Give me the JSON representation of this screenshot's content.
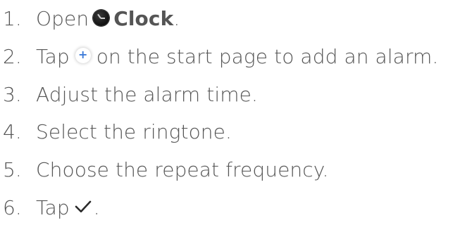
{
  "steps": [
    {
      "number": "1.",
      "before": "Open",
      "icon": "clock-app-icon",
      "app_name": "Clock",
      "after": "."
    },
    {
      "number": "2.",
      "before": "Tap",
      "icon": "add-icon",
      "icon_glyph": "+",
      "after": "on the start page to add an alarm."
    },
    {
      "number": "3.",
      "text": "Adjust the alarm time."
    },
    {
      "number": "4.",
      "text": "Select the ringtone."
    },
    {
      "number": "5.",
      "text": "Choose the repeat frequency."
    },
    {
      "number": "6.",
      "before": "Tap",
      "icon": "checkmark-icon",
      "after": "."
    }
  ],
  "colors": {
    "text": "#555555",
    "accent": "#3d7bd8",
    "background": "#ffffff"
  }
}
